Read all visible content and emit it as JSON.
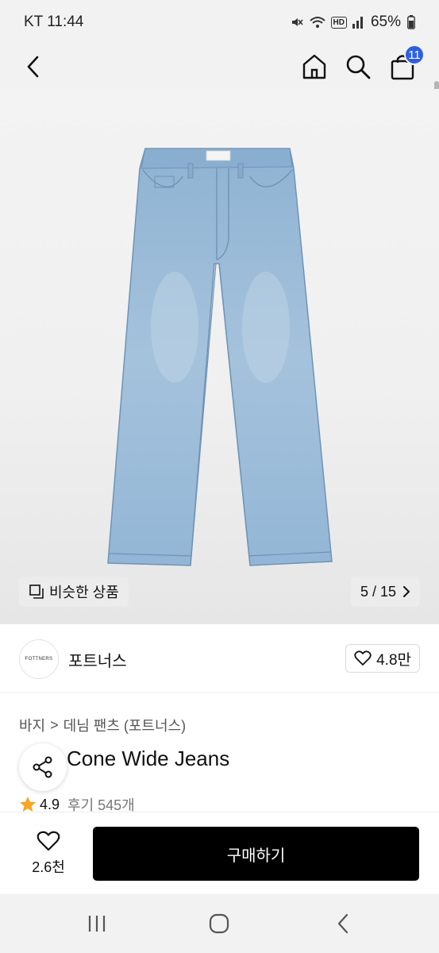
{
  "status_bar": {
    "carrier_time": "KT 11:44",
    "hd_label": "HD",
    "battery": "65%",
    "icons": [
      "mute-icon",
      "wifi-icon",
      "hd-icon",
      "signal-icon",
      "battery-icon"
    ]
  },
  "top_nav": {
    "icons": [
      "back-icon",
      "home-icon",
      "search-icon",
      "cart-icon"
    ],
    "cart_count": "11"
  },
  "product_image": {
    "similar_label": "비슷한 상품",
    "counter": "5 / 15"
  },
  "brand": {
    "logo_text": "FOTTNERS",
    "name": "포트너스",
    "likes": "4.8만"
  },
  "breadcrumb": {
    "category": "바지",
    "separator": ">",
    "subcategory": "데님 팬츠 (포트너스)"
  },
  "product": {
    "title": "Cone Wide Jeans",
    "rating": "4.9",
    "reviews": "후기 545개"
  },
  "action_bar": {
    "wish_count": "2.6천",
    "buy_label": "구매하기"
  },
  "colors": {
    "accent_badge": "#2f5fe0",
    "star": "#f5a623",
    "buy_button": "#000000",
    "denim": "#9dbcd8"
  }
}
